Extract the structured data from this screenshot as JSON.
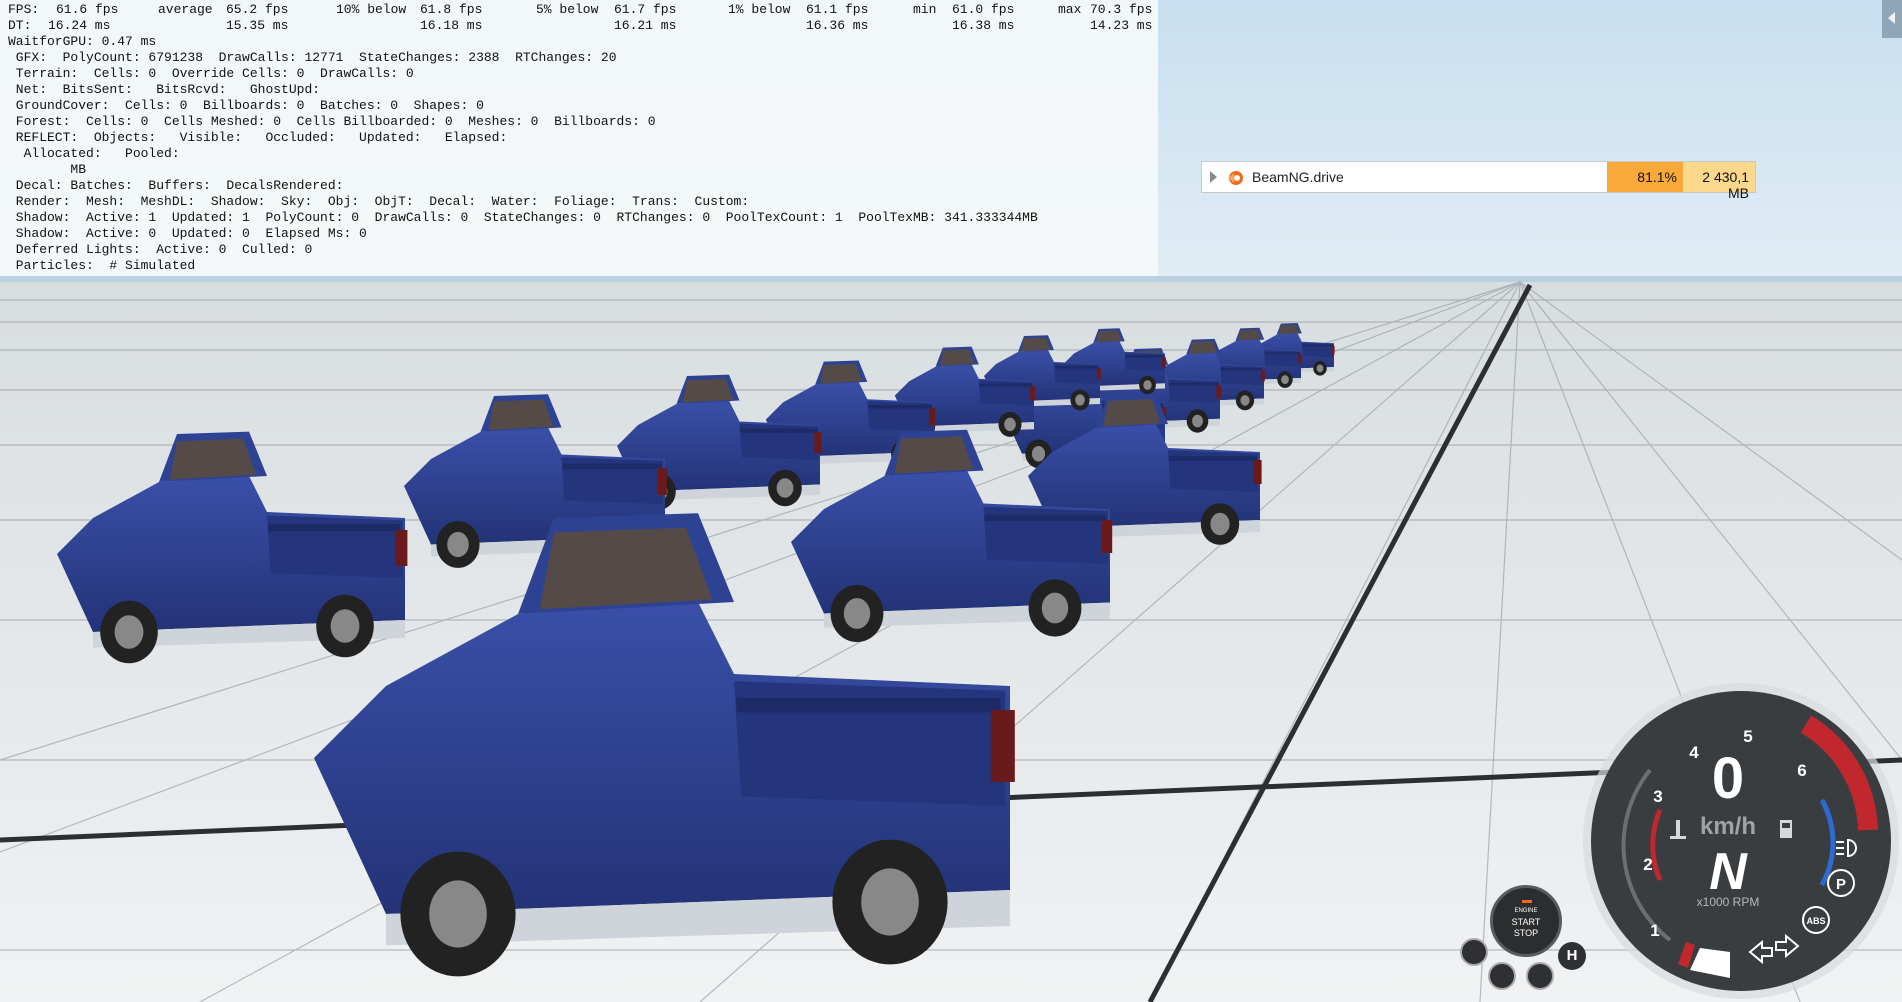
{
  "debug": {
    "fps": {
      "fps_label": "FPS:",
      "fps_value": "61.6 fps",
      "avg_label": "average",
      "avg_value": "65.2 fps",
      "p10_label": "10% below",
      "p10_value": "61.8 fps",
      "p5_label": "5% below",
      "p5_value": "61.7 fps",
      "p1_label": "1% below",
      "p1_value": "61.1 fps",
      "min_label": "min",
      "min_value": "61.0 fps",
      "max_label": "max",
      "max_value": "70.3 fps"
    },
    "dt": {
      "dt_label": "DT:",
      "dt_value": "16.24 ms",
      "avg": "15.35 ms",
      "p10": "16.18 ms",
      "p5": "16.21 ms",
      "p1": "16.36 ms",
      "min": "16.38 ms",
      "max": "14.23 ms"
    },
    "lines": [
      "WaitforGPU: 0.47 ms",
      " GFX:  PolyCount: 6791238  DrawCalls: 12771  StateChanges: 2388  RTChanges: 20",
      " Terrain:  Cells: 0  Override Cells: 0  DrawCalls: 0",
      " Net:  BitsSent:   BitsRcvd:   GhostUpd:",
      " GroundCover:  Cells: 0  Billboards: 0  Batches: 0  Shapes: 0",
      " Forest:  Cells: 0  Cells Meshed: 0  Cells Billboarded: 0  Meshes: 0  Billboards: 0",
      " REFLECT:  Objects:   Visible:   Occluded:   Updated:   Elapsed:",
      "  Allocated:   Pooled:",
      "        MB",
      " Decal: Batches:  Buffers:  DecalsRendered:",
      " Render:  Mesh:  MeshDL:  Shadow:  Sky:  Obj:  ObjT:  Decal:  Water:  Foliage:  Trans:  Custom:",
      " Shadow:  Active: 1  Updated: 1  PolyCount: 0  DrawCalls: 0  StateChanges: 0  RTChanges: 0  PoolTexCount: 1  PoolTexMB: 341.333344MB",
      " Shadow:  Active: 0  Updated: 0  Elapsed Ms: 0",
      " Deferred Lights:  Active: 0  Culled: 0",
      " Particles:  # Simulated"
    ]
  },
  "task_manager": {
    "process_name": "BeamNG.drive",
    "cpu": "81.1%",
    "memory": "2 430,1 MB"
  },
  "dashboard": {
    "speed_value": "0",
    "speed_unit": "km/h",
    "gear": "N",
    "rpm_unit": "x1000 RPM",
    "rpm_ticks": [
      "1",
      "2",
      "3",
      "4",
      "5",
      "6"
    ],
    "rpm": 0,
    "abs_label": "ABS",
    "parking_label": "P",
    "engine_button": {
      "line1": "ENGINE",
      "line2": "START",
      "line3": "STOP"
    },
    "hold_label": "H"
  },
  "colors": {
    "sky": "#d4e6f2",
    "ground": "#e6ebee",
    "truck_body": "#2d3f8f",
    "cpu_bar": "#f7a93a",
    "mem_bar": "#fbd88b",
    "redline": "#c0282d",
    "gauge_bg": "#3a3d40"
  }
}
